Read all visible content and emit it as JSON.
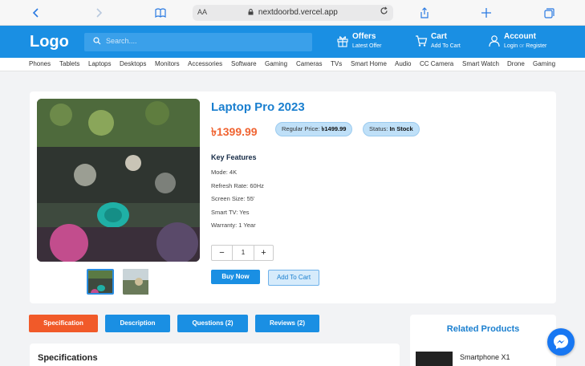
{
  "browser": {
    "aa_label": "AA",
    "url": "nextdoorbd.vercel.app",
    "icons": [
      "back-icon",
      "forward-icon",
      "book-icon",
      "lock-icon",
      "reload-icon",
      "share-icon",
      "plus-icon",
      "tabs-icon"
    ]
  },
  "header": {
    "logo": "Logo",
    "search_placeholder": "Search....",
    "offers": {
      "title": "Offers",
      "subtitle": "Latest Offer"
    },
    "cart": {
      "title": "Cart",
      "subtitle": "Add To Cart"
    },
    "account": {
      "title": "Account",
      "login": "Login",
      "or": "or",
      "register": "Register"
    },
    "color": "#1a8fe3"
  },
  "categories": [
    "Phones",
    "Tablets",
    "Laptops",
    "Desktops",
    "Monitors",
    "Accessories",
    "Software",
    "Gaming",
    "Cameras",
    "TVs",
    "Smart Home",
    "Audio",
    "CC Camera",
    "Smart Watch",
    "Drone",
    "Gaming"
  ],
  "product": {
    "title": "Laptop Pro 2023",
    "price": "৳1399.99",
    "regular_price_label": "Regular Price:",
    "regular_price": "৳1499.99",
    "status_label": "Status:",
    "status": "In Stock",
    "key_features_heading": "Key Features",
    "features": [
      "Mode: 4K",
      "Refresh Rate: 60Hz",
      "Screen Size: 55'",
      "Smart TV: Yes",
      "Warranty: 1 Year"
    ],
    "quantity": "1",
    "minus": "−",
    "plus": "+",
    "buy_now": "Buy Now",
    "add_to_cart": "Add To Cart"
  },
  "tabs": [
    "Specification",
    "Description",
    "Questions (2)",
    "Reviews (2)"
  ],
  "specifications_heading": "Specifications",
  "related": {
    "heading": "Related Products",
    "items": [
      {
        "name": "Smartphone X1"
      }
    ]
  },
  "colors": {
    "accent": "#1a8fe3",
    "price": "#f06432",
    "active_tab": "#f15a29"
  }
}
